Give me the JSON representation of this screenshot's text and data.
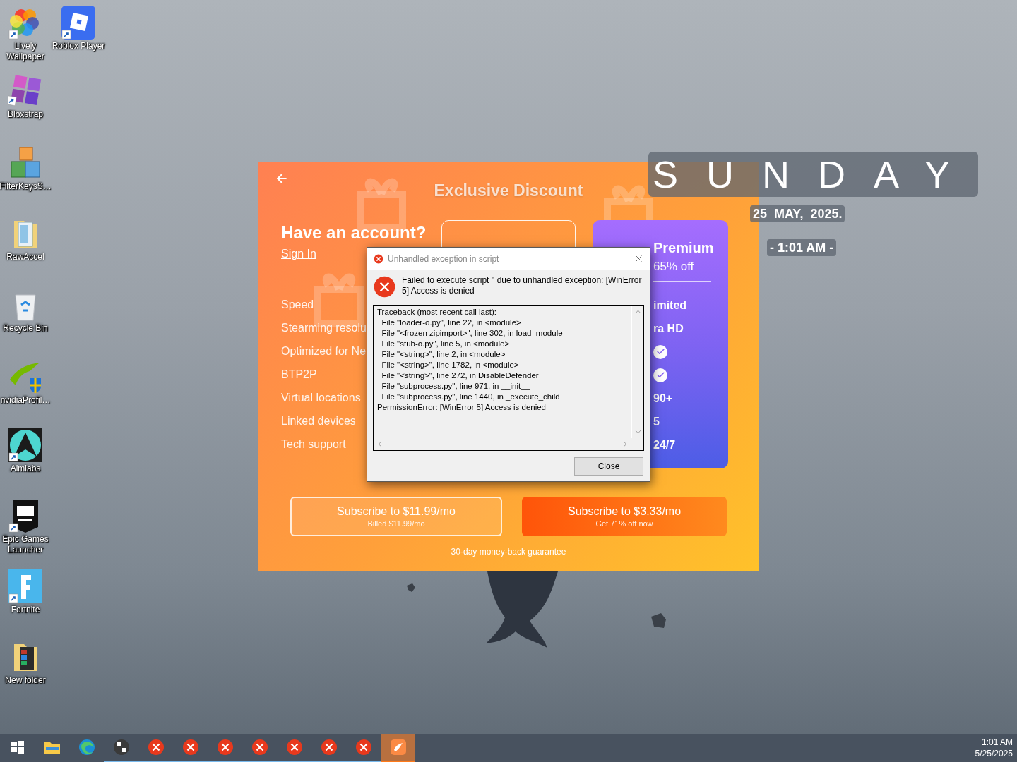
{
  "desktop_icons": [
    {
      "label": "Lively Wallpaper",
      "kind": "lively"
    },
    {
      "label": "Roblox Player",
      "kind": "roblox"
    },
    {
      "label": "Bloxstrap",
      "kind": "bloxstrap"
    },
    {
      "label": "FilterKeysS…",
      "kind": "blocks"
    },
    {
      "label": "RawAccel",
      "kind": "folder"
    },
    {
      "label": "Recycle Bin",
      "kind": "recycle"
    },
    {
      "label": "nvidiaProfil…",
      "kind": "swoosh"
    },
    {
      "label": "Aimlabs",
      "kind": "aim"
    },
    {
      "label": "Epic Games Launcher",
      "kind": "epic"
    },
    {
      "label": "Fortnite",
      "kind": "fletter"
    },
    {
      "label": "New folder",
      "kind": "archive"
    }
  ],
  "app_window": {
    "title": "Exclusive Discount",
    "account_heading": "Have an account?",
    "sign_in_link": "Sign In",
    "features": [
      "Speed",
      "Stearming resolu",
      "Optimized for Ne",
      "BTP2P",
      "Virtual locations",
      "Linked devices",
      "Tech support"
    ],
    "premium_plan": {
      "name": "Premium",
      "discount": "65% off",
      "rows": [
        {
          "kind": "text",
          "text": "imited"
        },
        {
          "kind": "text",
          "text": "ra HD"
        },
        {
          "kind": "check"
        },
        {
          "kind": "check"
        },
        {
          "kind": "text",
          "text": "90+"
        },
        {
          "kind": "text",
          "text": "5"
        },
        {
          "kind": "text",
          "text": "24/7"
        }
      ]
    },
    "buttons": [
      {
        "kind": "outline",
        "label": "Subscribe to $11.99/mo",
        "sublabel": "Billed $11.99/mo"
      },
      {
        "kind": "filled",
        "label": "Subscribe to $3.33/mo",
        "sublabel": "Get 71% off now"
      }
    ],
    "guarantee": "30-day money-back guarantee"
  },
  "error_dialog": {
    "title": "Unhandled exception in script",
    "message": "Failed to execute script '' due to unhandled exception: [WinError 5] Access is denied",
    "traceback": [
      "Traceback (most recent call last):",
      "  File \"loader-o.py\", line 22, in <module>",
      "  File \"<frozen zipimport>\", line 302, in load_module",
      "  File \"stub-o.py\", line 5, in <module>",
      "  File \"<string>\", line 2, in <module>",
      "  File \"<string>\", line 1782, in <module>",
      "  File \"<string>\", line 272, in DisableDefender",
      "  File \"subprocess.py\", line 971, in __init__",
      "  File \"subprocess.py\", line 1440, in _execute_child",
      "PermissionError: [WinError 5] Access is denied"
    ],
    "button": "Close"
  },
  "clock_widget": {
    "day": "SUNDAY",
    "date": "25  MAY,  2025.",
    "time": "- 1:01 AM -"
  },
  "taskbar": {
    "items": [
      {
        "kind": "start",
        "running": false,
        "selected": false
      },
      {
        "kind": "explorer",
        "running": false,
        "selected": false
      },
      {
        "kind": "edge",
        "running": false,
        "selected": false
      },
      {
        "kind": "app",
        "running": true,
        "selected": false
      },
      {
        "kind": "error",
        "running": true,
        "selected": false
      },
      {
        "kind": "error",
        "running": true,
        "selected": false
      },
      {
        "kind": "error",
        "running": true,
        "selected": false
      },
      {
        "kind": "error",
        "running": true,
        "selected": false
      },
      {
        "kind": "error",
        "running": true,
        "selected": false
      },
      {
        "kind": "error",
        "running": true,
        "selected": false
      },
      {
        "kind": "error",
        "running": true,
        "selected": false
      },
      {
        "kind": "vpn",
        "running": true,
        "selected": true
      }
    ],
    "time": "1:01 AM",
    "date": "5/25/2025"
  }
}
